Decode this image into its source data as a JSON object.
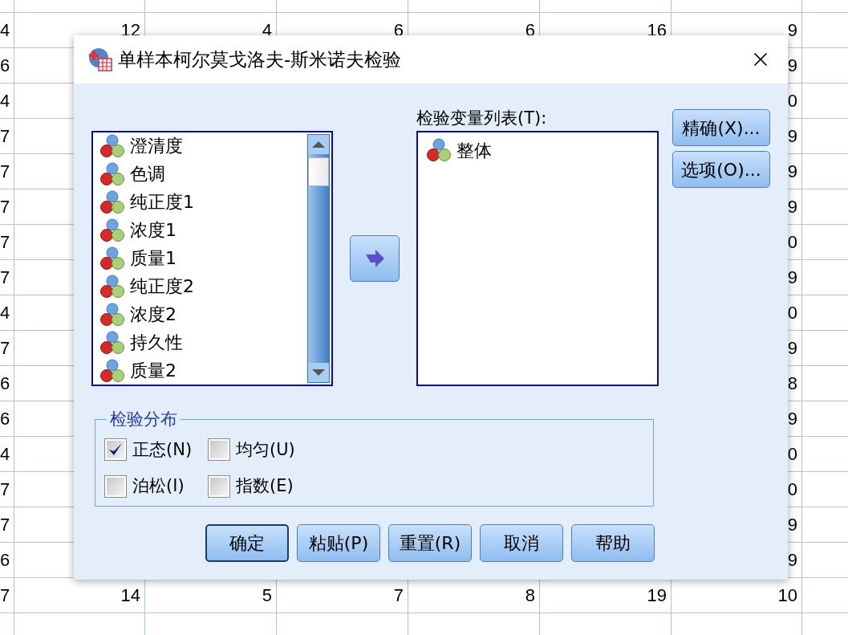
{
  "sheet": {
    "rows": [
      {
        "cells": [
          "4",
          "12",
          "4",
          "6",
          "6",
          "16",
          "9"
        ]
      },
      {
        "cells": [
          "6",
          "9"
        ]
      },
      {
        "cells": [
          "4",
          "0"
        ]
      },
      {
        "cells": [
          "7",
          "9"
        ]
      },
      {
        "cells": [
          "7",
          "9"
        ]
      },
      {
        "cells": [
          "7",
          "9"
        ]
      },
      {
        "cells": [
          "7",
          "0"
        ]
      },
      {
        "cells": [
          "7",
          "9"
        ]
      },
      {
        "cells": [
          "4",
          "0"
        ]
      },
      {
        "cells": [
          "7",
          "9"
        ]
      },
      {
        "cells": [
          "6",
          "8"
        ]
      },
      {
        "cells": [
          "6",
          "9"
        ]
      },
      {
        "cells": [
          "4",
          "0"
        ]
      },
      {
        "cells": [
          "7",
          "0"
        ]
      },
      {
        "cells": [
          "7",
          "9"
        ]
      },
      {
        "cells": [
          "6",
          "9"
        ]
      },
      {
        "cells": [
          "7",
          "14",
          "5",
          "7",
          "8",
          "19",
          "10"
        ]
      }
    ]
  },
  "dialog": {
    "title": "单样本柯尔莫戈洛夫-斯米诺夫检验",
    "source_list": {
      "items": [
        "澄清度",
        "色调",
        "纯正度1",
        "浓度1",
        "质量1",
        "纯正度2",
        "浓度2",
        "持久性",
        "质量2"
      ]
    },
    "target_list": {
      "label": "检验变量列表(T):",
      "items": [
        "整体"
      ]
    },
    "side_buttons": [
      "精确(X)...",
      "选项(O)..."
    ],
    "distribution": {
      "legend": "检验分布",
      "options": [
        {
          "label": "正态(N)",
          "checked": true
        },
        {
          "label": "均匀(U)",
          "checked": false
        },
        {
          "label": "泊松(I)",
          "checked": false
        },
        {
          "label": "指数(E)",
          "checked": false
        }
      ]
    },
    "buttons": [
      {
        "label": "确定",
        "default": true
      },
      {
        "label": "粘贴(P)",
        "default": false
      },
      {
        "label": "重置(R)",
        "default": false
      },
      {
        "label": "取消",
        "default": false
      },
      {
        "label": "帮助",
        "default": false
      }
    ]
  }
}
